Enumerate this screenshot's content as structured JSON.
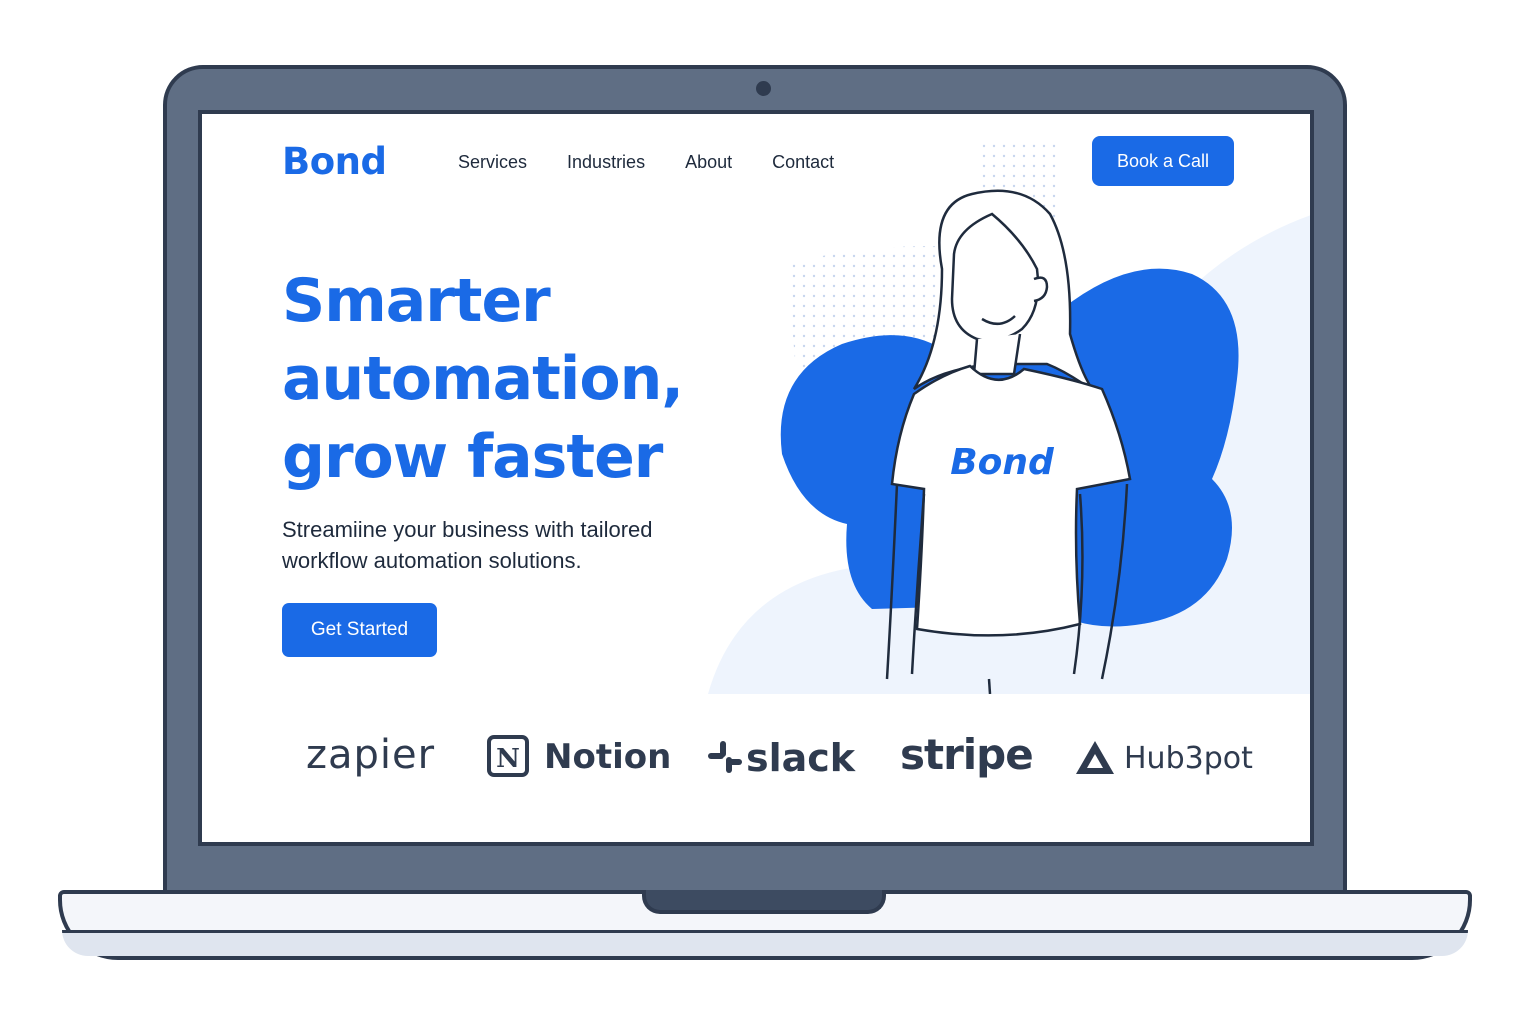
{
  "header": {
    "logo": "Bond",
    "nav": [
      "Services",
      "Industries",
      "About",
      "Contact"
    ],
    "cta_label": "Book a Call"
  },
  "hero": {
    "title_lines": [
      "Smarter",
      "automation,",
      "grow faster"
    ],
    "subtitle": "Streamiine your business with tailored workflow automation solutions.",
    "cta_label": "Get Started",
    "shirt_text": "Bond"
  },
  "partners": [
    "zapier",
    "Notion",
    "slack",
    "stripe",
    "Hub3pot"
  ],
  "colors": {
    "brand": "#1a6ae6",
    "text": "#1e2a3c",
    "frame": "#5f6e84",
    "frame_outline": "#2f3b4f"
  }
}
